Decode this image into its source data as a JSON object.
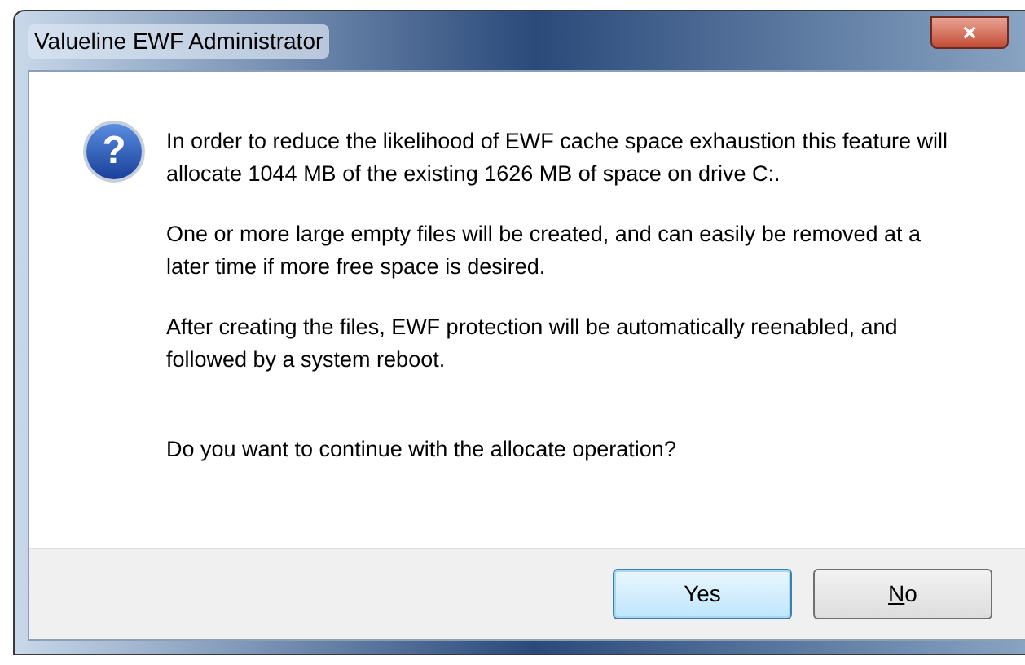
{
  "window": {
    "title": "Valueline EWF Administrator",
    "close": "×"
  },
  "message": {
    "icon": "?",
    "paragraphs": [
      "In order to reduce the likelihood of EWF cache space exhaustion this feature will allocate 1044 MB of the existing 1626 MB of space on drive C:.",
      "One or more large empty files will be created, and can easily be removed at a later time if more free space is desired.",
      "After creating the files, EWF protection will be automatically reenabled, and followed by a system reboot.",
      "Do you want to continue with the allocate operation?"
    ]
  },
  "buttons": [
    {
      "label": "Yes",
      "default": true,
      "underline_first": false
    },
    {
      "label": "No",
      "default": false,
      "underline_first": true
    }
  ]
}
